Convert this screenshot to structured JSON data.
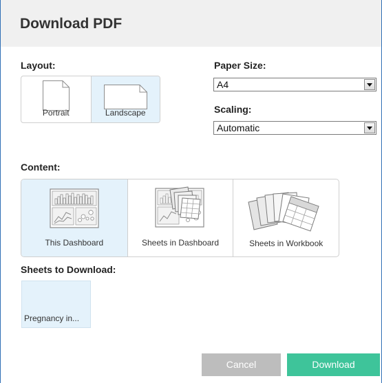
{
  "dialog": {
    "title": "Download PDF"
  },
  "layout": {
    "label": "Layout:",
    "options": [
      {
        "label": "Portrait",
        "selected": false,
        "icon": "portrait-page-icon"
      },
      {
        "label": "Landscape",
        "selected": true,
        "icon": "landscape-page-icon"
      }
    ]
  },
  "paper_size": {
    "label": "Paper Size:",
    "value": "A4"
  },
  "scaling": {
    "label": "Scaling:",
    "value": "Automatic"
  },
  "content": {
    "label": "Content:",
    "options": [
      {
        "label": "This Dashboard",
        "selected": true,
        "icon": "dashboard-icon"
      },
      {
        "label": "Sheets in Dashboard",
        "selected": false,
        "icon": "sheets-in-dashboard-icon"
      },
      {
        "label": "Sheets in Workbook",
        "selected": false,
        "icon": "sheets-in-workbook-icon"
      }
    ]
  },
  "sheets_to_download": {
    "label": "Sheets to Download:",
    "items": [
      {
        "label": "Pregnancy in...",
        "selected": true
      }
    ]
  },
  "buttons": {
    "cancel": "Cancel",
    "download": "Download"
  },
  "colors": {
    "selected_bg": "#e4f2fb",
    "download_button": "#3ec49a",
    "cancel_button": "#bdbdbd",
    "window_border": "#2f6fb5"
  }
}
